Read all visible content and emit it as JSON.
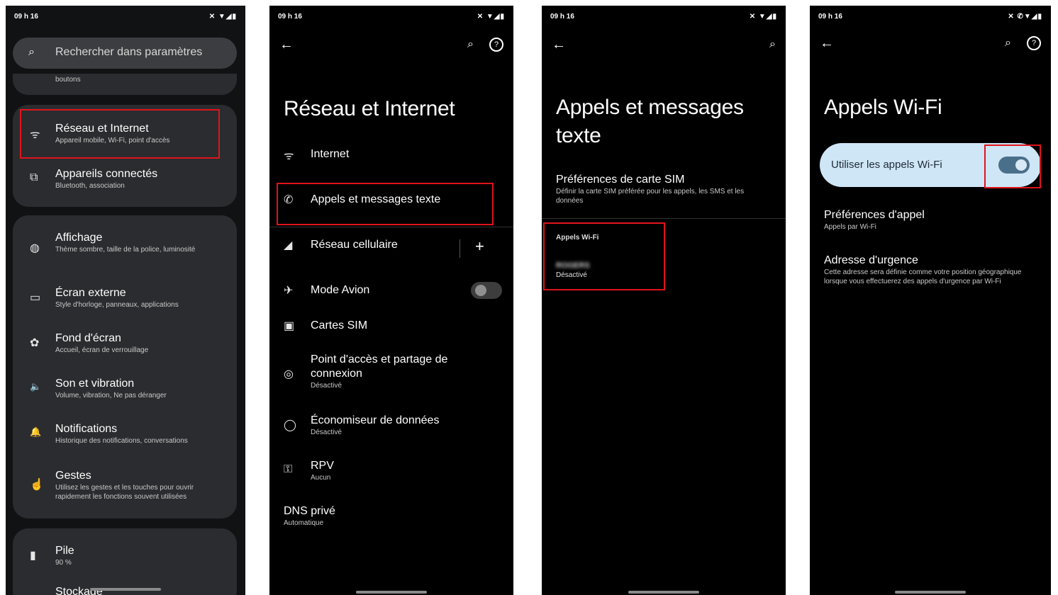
{
  "status": {
    "time": "09 h 16",
    "icons": "✕ ▼◢▮",
    "icons4": "✕ ✆▼◢▮"
  },
  "p1": {
    "search_placeholder": "Rechercher dans paramètres",
    "partial_sub": "boutons",
    "items": [
      {
        "title": "Réseau et Internet",
        "sub": "Appareil mobile, Wi-Fi, point d'accès"
      },
      {
        "title": "Appareils connectés",
        "sub": "Bluetooth, association"
      },
      {
        "title": "Affichage",
        "sub": "Thème sombre, taille de la police, luminosité"
      },
      {
        "title": "Écran externe",
        "sub": "Style d'horloge, panneaux, applications"
      },
      {
        "title": "Fond d'écran",
        "sub": "Accueil, écran de verrouillage"
      },
      {
        "title": "Son et vibration",
        "sub": "Volume, vibration, Ne pas déranger"
      },
      {
        "title": "Notifications",
        "sub": "Historique des notifications, conversations"
      },
      {
        "title": "Gestes",
        "sub": "Utilisez les gestes et les touches pour ouvrir rapidement les fonctions souvent utilisées"
      },
      {
        "title": "Pile",
        "sub": "90 %"
      },
      {
        "title": "Stockage",
        "sub": ""
      }
    ]
  },
  "p2": {
    "title": "Réseau et Internet",
    "items": [
      {
        "title": "Internet",
        "sub": ""
      },
      {
        "title": "Appels et messages texte",
        "sub": ""
      },
      {
        "title": "Réseau cellulaire",
        "sub": ""
      },
      {
        "title": "Mode Avion",
        "sub": ""
      },
      {
        "title": "Cartes SIM",
        "sub": ""
      },
      {
        "title": "Point d'accès et partage de connexion",
        "sub": "Désactivé"
      },
      {
        "title": "Économiseur de données",
        "sub": "Désactivé"
      },
      {
        "title": "RPV",
        "sub": "Aucun"
      },
      {
        "title": "DNS privé",
        "sub": "Automatique"
      }
    ],
    "add_label": "+"
  },
  "p3": {
    "title": "Appels et messages texte",
    "sim_pref_title": "Préférences de carte SIM",
    "sim_pref_sub": "Définir la carte SIM préférée pour les appels, les SMS et les données",
    "section": "Appels Wi-Fi",
    "carrier": "ROGERS",
    "state": "Désactivé"
  },
  "p4": {
    "title": "Appels Wi-Fi",
    "toggle_label": "Utiliser les appels Wi-Fi",
    "toggle_on": true,
    "pref_title": "Préférences d'appel",
    "pref_sub": "Appels par Wi-Fi",
    "addr_title": "Adresse d'urgence",
    "addr_sub": "Cette adresse sera définie comme votre position géographique lorsque vous effectuerez des appels d'urgence par Wi-Fi"
  },
  "icons": {
    "back": "←",
    "search": "⌕",
    "help": "?",
    "wifi": "ᯤ",
    "devices": "⧉",
    "display": "◍",
    "screen": "▭",
    "wallpaper": "✿",
    "sound": "🔈",
    "bell": "🔔",
    "gesture": "☝",
    "battery": "▮",
    "signal": "◢",
    "plane": "✈",
    "sim": "▣",
    "hotspot": "◎",
    "datasaver": "◯",
    "vpn": "⚿",
    "phone": "✆"
  },
  "colors": {
    "accent_red": "#e0141b",
    "toggle_card": "#cfe6f7",
    "toggle_track": "#4a6f8a",
    "toggle_knob": "#d9e9f5"
  }
}
